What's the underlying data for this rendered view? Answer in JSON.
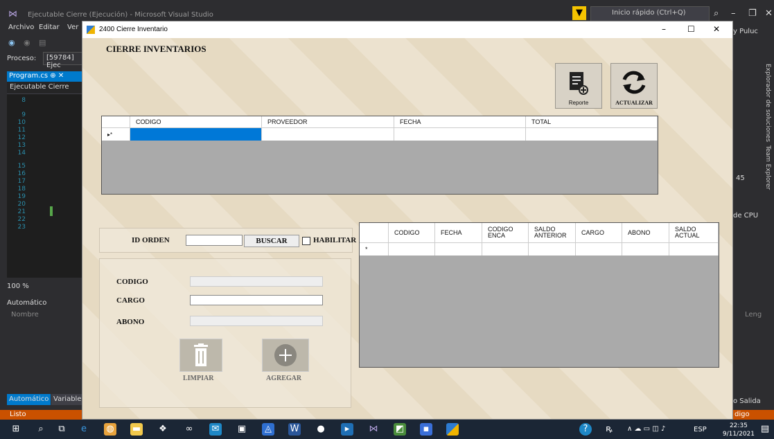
{
  "vs": {
    "title": "Ejecutable Cierre (Ejecución) - Microsoft Visual Studio",
    "quick_launch": "Inicio rápido (Ctrl+Q)",
    "menu": [
      "Archivo",
      "Editar",
      "Ver"
    ],
    "proceso_label": "Proceso:",
    "proceso_value": "[59784] Ejec",
    "tab_program": "Program.cs ⊕ ✕",
    "exe_combo": "Ejecutable Cierre",
    "line_numbers": [
      "8",
      "9",
      "10",
      "11",
      "12",
      "13",
      "14",
      "15",
      "16",
      "17",
      "18",
      "19",
      "20",
      "21",
      "22",
      "23"
    ],
    "zoom": "100 %",
    "autos_title": "Automático",
    "autos_col": "Nombre",
    "bottom_tabs": [
      "Automático",
      "Variables"
    ],
    "user_partial": "y Puluc",
    "explorer_tab": "Explorador de soluciones",
    "team_tab": "Team Explorer",
    "cpu_label": "de CPU",
    "num_45": "45",
    "leng": "Leng",
    "salida": "o  Salida",
    "status_left": "Listo",
    "status_right": "digo fuente",
    "taskbar_lang": "ESP",
    "taskbar_time": "22:35",
    "taskbar_date": "9/11/2021"
  },
  "window": {
    "title": "2400 Cierre Inventario",
    "form_title": "CIERRE INVENTARIOS",
    "btn_reporte": "Reporte",
    "btn_actualizar": "ACTUALIZAR",
    "grid1": {
      "columns": [
        "CODIGO",
        "PROVEEDOR",
        "FECHA",
        "TOTAL"
      ],
      "row_marker": "▸*"
    },
    "grid2": {
      "columns": [
        "CODIGO",
        "FECHA",
        "CODIGO ENCA",
        "SALDO ANTERIOR",
        "CARGO",
        "ABONO",
        "SALDO ACTUAL"
      ],
      "row_marker": "*"
    },
    "id_orden_label": "ID ORDEN",
    "buscar_label": "BUSCAR",
    "habilitar_label": "HABILITAR",
    "codigo_label": "CODIGO",
    "cargo_label": "CARGO",
    "abono_label": "ABONO",
    "limpiar_label": "LIMPIAR",
    "agregar_label": "AGREGAR"
  }
}
